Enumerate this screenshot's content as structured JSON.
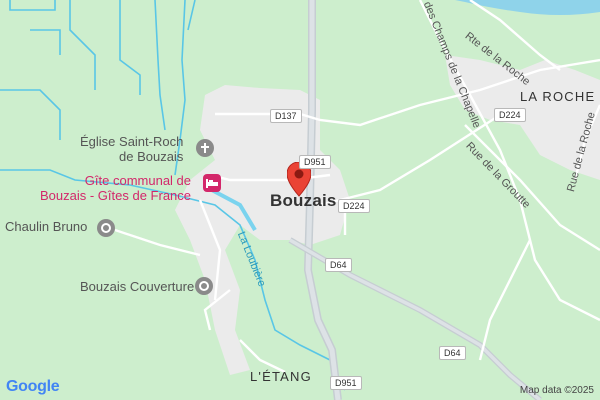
{
  "map": {
    "town_label": "Bouzais",
    "places": {
      "la_roche": "LA ROCHE",
      "l_etang": "L'ÉTANG"
    },
    "pois": {
      "eglise": "Église Saint-Roch\nde Bouzais",
      "gite": "Gîte communal de\nBouzais - Gîtes de France",
      "chaulin": "Chaulin Bruno",
      "couverture": "Bouzais Couverture"
    },
    "road_shields": {
      "d137": "D137",
      "d951_top": "D951",
      "d224_center": "D224",
      "d224_right": "D224",
      "d64_mid": "D64",
      "d64_right": "D64",
      "d951_bottom": "D951"
    },
    "streets": {
      "rte_roche": "Rte de la Roche",
      "champs_chapelle": "des Champs de la Chapelle",
      "rue_groutte": "Rue de la Groutte",
      "rue_roche": "Rue de la Roche"
    },
    "river": "La Loubière",
    "icons": {
      "marker": "map-pin-icon",
      "church": "cross-icon",
      "lodging": "bed-icon",
      "place": "place-icon"
    },
    "colors": {
      "land": "#cdeecd",
      "urban": "#ebebeb",
      "water": "#59c6e6",
      "marker": "#ea4335"
    }
  },
  "footer": {
    "logo": "Google",
    "attribution": "Map data ©2025"
  }
}
